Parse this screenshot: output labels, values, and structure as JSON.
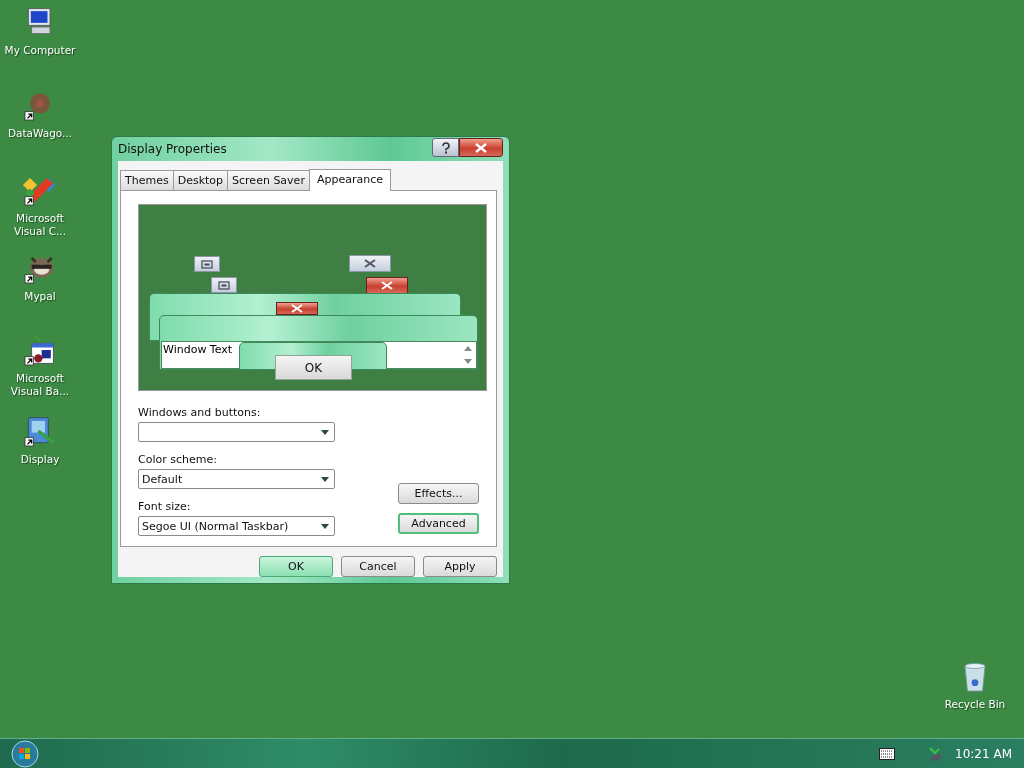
{
  "desktop": {
    "icons": [
      {
        "label": "My Computer",
        "kind": "computer",
        "shortcut": false
      },
      {
        "label": "DataWago...",
        "kind": "blur",
        "shortcut": true
      },
      {
        "label": "Microsoft Visual C...",
        "kind": "studio",
        "shortcut": true
      },
      {
        "label": "Mypal",
        "kind": "raccoon",
        "shortcut": true
      },
      {
        "label": "Microsoft Visual Ba...",
        "kind": "calendar",
        "shortcut": true
      },
      {
        "label": "Display",
        "kind": "display",
        "shortcut": true
      },
      {
        "label": "Recycle Bin",
        "kind": "bin",
        "shortcut": false
      }
    ]
  },
  "dialog": {
    "title": "Display Properties",
    "tabs": [
      {
        "label": "Themes",
        "selected": false
      },
      {
        "label": "Desktop",
        "selected": false
      },
      {
        "label": "Screen Saver",
        "selected": false
      },
      {
        "label": "Appearance",
        "selected": true
      }
    ],
    "preview": {
      "window_text": "Window Text",
      "button": "OK"
    },
    "fields": [
      {
        "label": "Windows and buttons:"
      },
      {
        "label": "Color scheme:",
        "value": "Default"
      },
      {
        "label": "Font size:",
        "value": "Segoe UI (Normal Taskbar)"
      }
    ],
    "side_buttons": [
      {
        "label": "Effects...",
        "focused": false
      },
      {
        "label": "Advanced",
        "focused": true
      }
    ],
    "buttons": [
      {
        "label": "OK",
        "default": true
      },
      {
        "label": "Cancel",
        "default": false
      },
      {
        "label": "Apply",
        "default": false
      }
    ]
  },
  "taskbar": {
    "clock": "10:21 AM"
  }
}
